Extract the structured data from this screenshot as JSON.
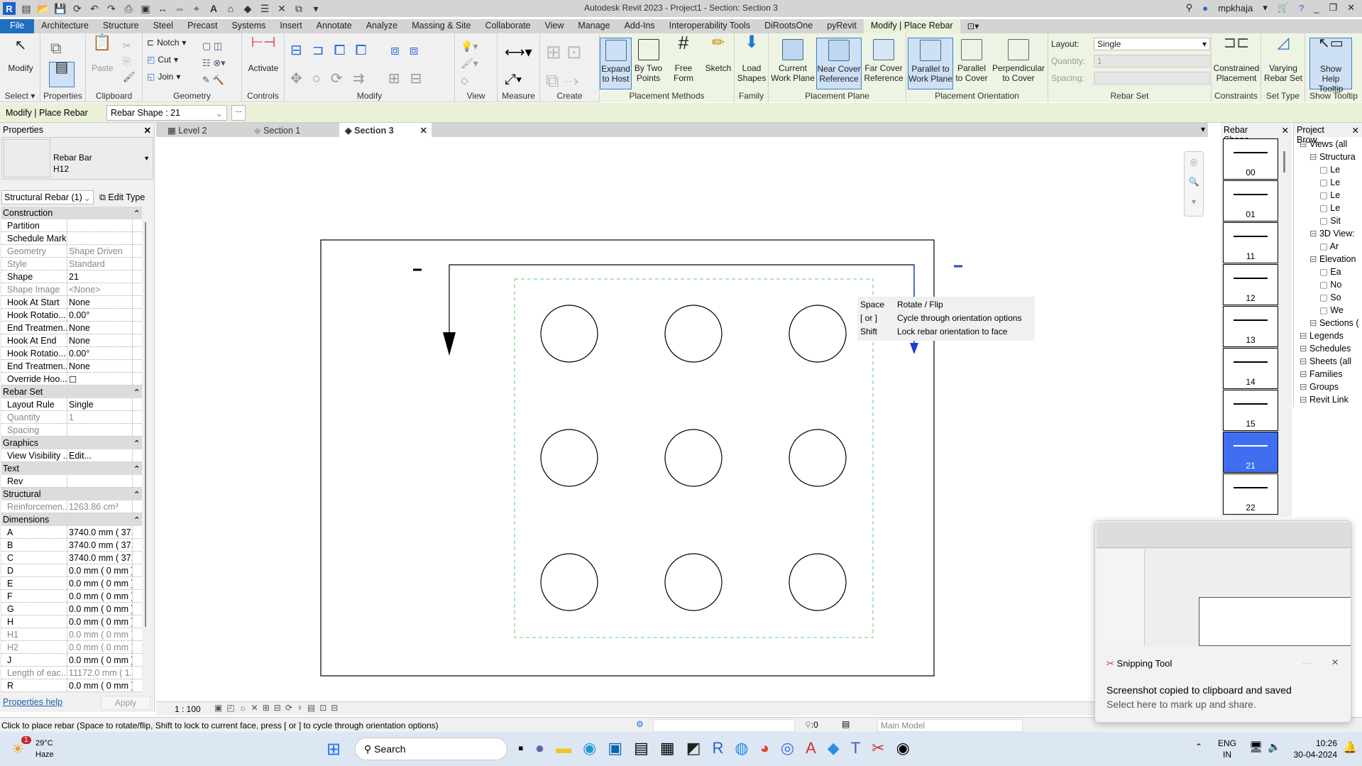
{
  "app": {
    "title": "Autodesk Revit 2023 - Project1 - Section: Section 3",
    "user": "mpkhaja"
  },
  "menu_tabs": [
    "File",
    "Architecture",
    "Structure",
    "Steel",
    "Precast",
    "Systems",
    "Insert",
    "Annotate",
    "Analyze",
    "Massing & Site",
    "Collaborate",
    "View",
    "Manage",
    "Add-Ins",
    "Interoperability Tools",
    "DiRootsOne",
    "pyRevit",
    "Modify | Place Rebar"
  ],
  "ribbon": {
    "select": {
      "modify": "Modify",
      "label": "Select ▾"
    },
    "properties": {
      "label": "Properties"
    },
    "clipboard": {
      "paste": "Paste",
      "label": "Clipboard"
    },
    "geometry": {
      "notch": "Notch",
      "cut": "Cut",
      "join": "Join",
      "label": "Geometry"
    },
    "controls": {
      "activate": "Activate",
      "label": "Controls"
    },
    "modify": {
      "label": "Modify"
    },
    "view": {
      "label": "View"
    },
    "measure": {
      "label": "Measure"
    },
    "create": {
      "label": "Create"
    },
    "placement_methods": {
      "label": "Placement Methods",
      "items": [
        "Expand to Host",
        "By Two Points",
        "Free Form",
        "Sketch"
      ]
    },
    "family": {
      "label": "Family",
      "items": [
        "Load Shapes"
      ]
    },
    "placement_plane": {
      "label": "Placement Plane",
      "items": [
        "Current Work Plane",
        "Near Cover Reference",
        "Far Cover Reference"
      ]
    },
    "placement_orientation": {
      "label": "Placement Orientation",
      "items": [
        "Parallel to Work Plane",
        "Parallel to Cover",
        "Perpendicular to Cover"
      ]
    },
    "rebar_set": {
      "label": "Rebar Set",
      "layout_label": "Layout:",
      "layout_value": "Single",
      "quantity_label": "Quantity:",
      "quantity_value": "1",
      "spacing_label": "Spacing:",
      "spacing_value": ""
    },
    "constraints": {
      "label": "Constraints",
      "item": "Constrained Placement"
    },
    "set_type": {
      "label": "Set Type",
      "item": "Varying Rebar Set"
    },
    "show_tooltip": {
      "label": "Show Tooltip",
      "item": "Show Help Tooltip"
    }
  },
  "options_bar": {
    "context": "Modify | Place Rebar",
    "rebar_shape": "Rebar Shape : 21",
    "more": "..."
  },
  "properties": {
    "title": "Properties",
    "type_name_1": "Rebar Bar",
    "type_name_2": "H12",
    "selector": "Structural Rebar (1)",
    "edit_type": "Edit Type",
    "sections": [
      {
        "name": "Construction",
        "rows": [
          {
            "k": "Partition",
            "v": "",
            "dis": false
          },
          {
            "k": "Schedule Mark",
            "v": "",
            "dis": false
          },
          {
            "k": "Geometry",
            "v": "Shape Driven",
            "dis": true
          },
          {
            "k": "Style",
            "v": "Standard",
            "dis": true
          },
          {
            "k": "Shape",
            "v": "21",
            "dis": false
          },
          {
            "k": "Shape Image",
            "v": "<None>",
            "dis": true
          },
          {
            "k": "Hook At Start",
            "v": "None",
            "dis": false
          },
          {
            "k": "Hook Rotatio...",
            "v": "0.00°",
            "dis": false
          },
          {
            "k": "End Treatmen...",
            "v": "None",
            "dis": false
          },
          {
            "k": "Hook At End",
            "v": "None",
            "dis": false
          },
          {
            "k": "Hook Rotatio...",
            "v": "0.00°",
            "dis": false
          },
          {
            "k": "End Treatmen...",
            "v": "None",
            "dis": false
          },
          {
            "k": "Override Hoo...",
            "v": "☐",
            "dis": false
          }
        ]
      },
      {
        "name": "Rebar Set",
        "rows": [
          {
            "k": "Layout Rule",
            "v": "Single",
            "dis": false
          },
          {
            "k": "Quantity",
            "v": "1",
            "dis": true
          },
          {
            "k": "Spacing",
            "v": "",
            "dis": true
          }
        ]
      },
      {
        "name": "Graphics",
        "rows": [
          {
            "k": "View Visibility ...",
            "v": "Edit...",
            "dis": false
          }
        ]
      },
      {
        "name": "Text",
        "rows": [
          {
            "k": "Rev",
            "v": "",
            "dis": false
          }
        ]
      },
      {
        "name": "Structural",
        "rows": [
          {
            "k": "Reinforcemen...",
            "v": "1263.86 cm³",
            "dis": true
          }
        ]
      },
      {
        "name": "Dimensions",
        "rows": [
          {
            "k": "A",
            "v": "3740.0 mm ( 37...",
            "dis": false
          },
          {
            "k": "B",
            "v": "3740.0 mm ( 37...",
            "dis": false
          },
          {
            "k": "C",
            "v": "3740.0 mm ( 37...",
            "dis": false
          },
          {
            "k": "D",
            "v": "0.0 mm ( 0 mm )",
            "dis": false
          },
          {
            "k": "E",
            "v": "0.0 mm ( 0 mm )",
            "dis": false
          },
          {
            "k": "F",
            "v": "0.0 mm ( 0 mm )",
            "dis": false
          },
          {
            "k": "G",
            "v": "0.0 mm ( 0 mm )",
            "dis": false
          },
          {
            "k": "H",
            "v": "0.0 mm ( 0 mm )",
            "dis": false
          },
          {
            "k": "H1",
            "v": "0.0 mm ( 0 mm )",
            "dis": true
          },
          {
            "k": "H2",
            "v": "0.0 mm ( 0 mm )",
            "dis": true
          },
          {
            "k": "J",
            "v": "0.0 mm ( 0 mm )",
            "dis": false
          },
          {
            "k": "Length of eac...",
            "v": "11172.0 mm ( 1...",
            "dis": true
          },
          {
            "k": "R",
            "v": "0.0 mm ( 0 mm )",
            "dis": false
          }
        ]
      }
    ],
    "help": "Properties help",
    "apply": "Apply"
  },
  "view_tabs": [
    {
      "label": "Level 2",
      "active": false
    },
    {
      "label": "Section 1",
      "active": false
    },
    {
      "label": "Section 3",
      "active": true
    }
  ],
  "tooltip": [
    {
      "k": "Space",
      "v": "Rotate / Flip"
    },
    {
      "k": "[ or ]",
      "v": "Cycle through orientation options"
    },
    {
      "k": "Shift",
      "v": "Lock rebar orientation to face"
    }
  ],
  "view_bar": {
    "scale": "1 : 100"
  },
  "rebar_shapes": {
    "title": "Rebar Shape...",
    "items": [
      "00",
      "01",
      "11",
      "12",
      "13",
      "14",
      "15",
      "21",
      "22"
    ],
    "selected": "21"
  },
  "project_browser": {
    "title": "Project Brow...",
    "items": [
      "Views (all",
      "Structura",
      "Le",
      "Le",
      "Le",
      "Le",
      "Sit",
      "3D View:",
      "Ar",
      "Elevation",
      "Ea",
      "No",
      "So",
      "We",
      "Sections (",
      "Legends",
      "Schedules",
      "Sheets (all",
      "Families",
      "Groups",
      "Revit Link"
    ]
  },
  "status": {
    "message": "Click to place rebar (Space to rotate/flip, Shift to lock to current face, press [ or ] to cycle through orientation options)",
    "filter_count": ":0",
    "model": "Main Model"
  },
  "toast": {
    "app": "Snipping Tool",
    "line1": "Screenshot copied to clipboard and saved",
    "line2": "Select here to mark up and share."
  },
  "taskbar": {
    "weather_temp": "29°C",
    "weather_desc": "Haze",
    "badge": "1",
    "search": "Search",
    "lang1": "ENG",
    "lang2": "IN",
    "time": "10:26",
    "date": "30-04-2024"
  }
}
